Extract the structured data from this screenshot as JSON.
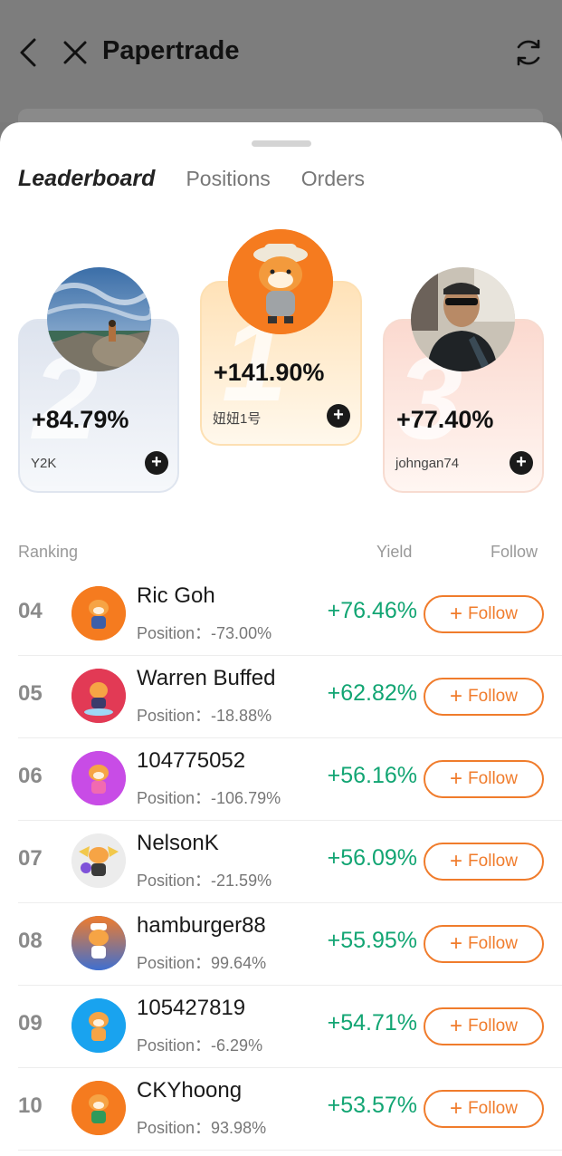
{
  "header": {
    "title": "Papertrade"
  },
  "tabs": [
    {
      "label": "Leaderboard"
    },
    {
      "label": "Positions"
    },
    {
      "label": "Orders"
    }
  ],
  "podium": {
    "first": {
      "rank": "1",
      "yield": "+141.90%",
      "name": "妞妞1号"
    },
    "second": {
      "rank": "2",
      "yield": "+84.79%",
      "name": "Y2K"
    },
    "third": {
      "rank": "3",
      "yield": "+77.40%",
      "name": "johngan74"
    }
  },
  "list_header": {
    "ranking": "Ranking",
    "yield": "Yield",
    "follow": "Follow"
  },
  "follow_label": "Follow",
  "rows": [
    {
      "rank": "04",
      "name": "Ric Goh",
      "position": "Position：-73.00%",
      "yield": "+76.46%"
    },
    {
      "rank": "05",
      "name": "Warren Buffed",
      "position": "Position：-18.88%",
      "yield": "+62.82%"
    },
    {
      "rank": "06",
      "name": "104775052",
      "position": "Position：-106.79%",
      "yield": "+56.16%"
    },
    {
      "rank": "07",
      "name": "NelsonK",
      "position": "Position：-21.59%",
      "yield": "+56.09%"
    },
    {
      "rank": "08",
      "name": "hamburger88",
      "position": "Position：99.64%",
      "yield": "+55.95%"
    },
    {
      "rank": "09",
      "name": "105427819",
      "position": "Position：-6.29%",
      "yield": "+54.71%"
    },
    {
      "rank": "10",
      "name": "CKYhoong",
      "position": "Position：93.98%",
      "yield": "+53.57%"
    }
  ],
  "colors": {
    "accent": "#f07c2c",
    "positive": "#12a573"
  }
}
